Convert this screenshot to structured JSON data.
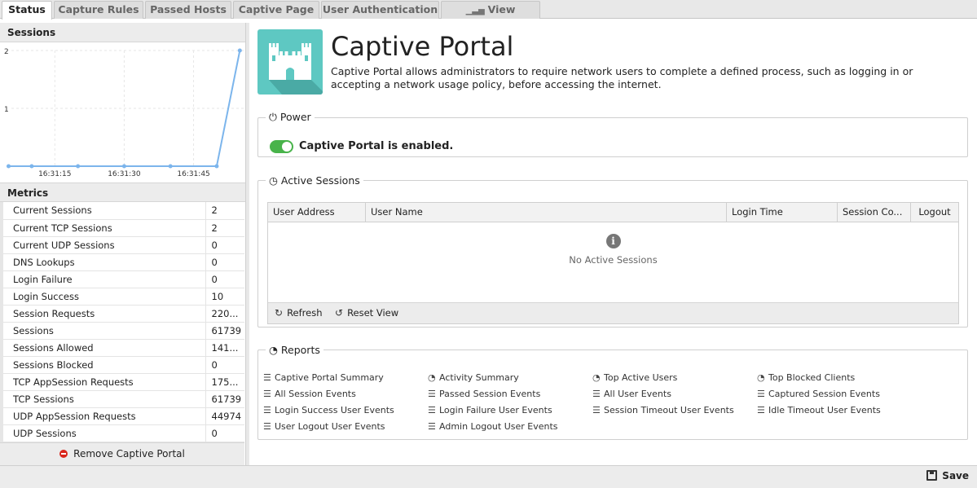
{
  "tabs": [
    {
      "label": "Status",
      "active": true
    },
    {
      "label": "Capture Rules",
      "active": false
    },
    {
      "label": "Passed Hosts",
      "active": false
    },
    {
      "label": "Captive Page",
      "active": false
    },
    {
      "label": "User Authentication",
      "active": false
    },
    {
      "label": "View Reports",
      "active": false,
      "icon": "bar-chart-icon"
    }
  ],
  "sessions_panel": {
    "title": "Sessions"
  },
  "chart_data": {
    "type": "line",
    "x": [
      "16:31:05",
      "16:31:10",
      "16:31:20",
      "16:31:30",
      "16:31:40",
      "16:31:50",
      "16:31:55"
    ],
    "series": [
      {
        "values": [
          0,
          0,
          0,
          0,
          0,
          0,
          2
        ],
        "color": "#7cb5ec"
      }
    ],
    "x_tick_labels": [
      "16:31:15",
      "16:31:30",
      "16:31:45"
    ],
    "y_tick_labels": [
      "1",
      "2"
    ],
    "ylim": [
      0,
      2
    ],
    "grid": true
  },
  "metrics_panel": {
    "title": "Metrics",
    "rows": [
      {
        "name": "Current Sessions",
        "value": "2"
      },
      {
        "name": "Current TCP Sessions",
        "value": "2"
      },
      {
        "name": "Current UDP Sessions",
        "value": "0"
      },
      {
        "name": "DNS Lookups",
        "value": "0"
      },
      {
        "name": "Login Failure",
        "value": "0"
      },
      {
        "name": "Login Success",
        "value": "10"
      },
      {
        "name": "Session Requests",
        "value": "220..."
      },
      {
        "name": "Sessions",
        "value": "61739"
      },
      {
        "name": "Sessions Allowed",
        "value": "141..."
      },
      {
        "name": "Sessions Blocked",
        "value": "0"
      },
      {
        "name": "TCP AppSession Requests",
        "value": "175..."
      },
      {
        "name": "TCP Sessions",
        "value": "61739"
      },
      {
        "name": "UDP AppSession Requests",
        "value": "44974"
      },
      {
        "name": "UDP Sessions",
        "value": "0"
      }
    ],
    "remove_label": "Remove Captive Portal"
  },
  "app": {
    "title": "Captive Portal",
    "description": "Captive Portal allows administrators to require network users to complete a defined process, such as logging in or accepting a network usage policy, before accessing the internet.",
    "icon_color": "#5ec8c2"
  },
  "power": {
    "legend": "Power",
    "enabled": true,
    "status_text": "Captive Portal is enabled."
  },
  "active_sessions": {
    "legend": "Active Sessions",
    "columns": [
      "User Address",
      "User Name",
      "Login Time",
      "Session Co...",
      "Logout"
    ],
    "empty_text": "No Active Sessions",
    "refresh_label": "Refresh",
    "reset_label": "Reset View"
  },
  "reports": {
    "legend": "Reports",
    "items": [
      {
        "label": "Captive Portal Summary",
        "icon": "list-icon"
      },
      {
        "label": "Activity Summary",
        "icon": "pie-chart-icon"
      },
      {
        "label": "Top Active Users",
        "icon": "pie-chart-icon"
      },
      {
        "label": "Top Blocked Clients",
        "icon": "pie-chart-icon"
      },
      {
        "label": "All Session Events",
        "icon": "list-icon"
      },
      {
        "label": "Passed Session Events",
        "icon": "list-icon"
      },
      {
        "label": "All User Events",
        "icon": "list-icon"
      },
      {
        "label": "Captured Session Events",
        "icon": "list-icon"
      },
      {
        "label": "Login Success User Events",
        "icon": "list-icon"
      },
      {
        "label": "Login Failure User Events",
        "icon": "list-icon"
      },
      {
        "label": "Session Timeout User Events",
        "icon": "list-icon"
      },
      {
        "label": "Idle Timeout User Events",
        "icon": "list-icon"
      },
      {
        "label": "User Logout User Events",
        "icon": "list-icon"
      },
      {
        "label": "Admin Logout User Events",
        "icon": "list-icon"
      }
    ]
  },
  "footer": {
    "save_label": "Save"
  }
}
